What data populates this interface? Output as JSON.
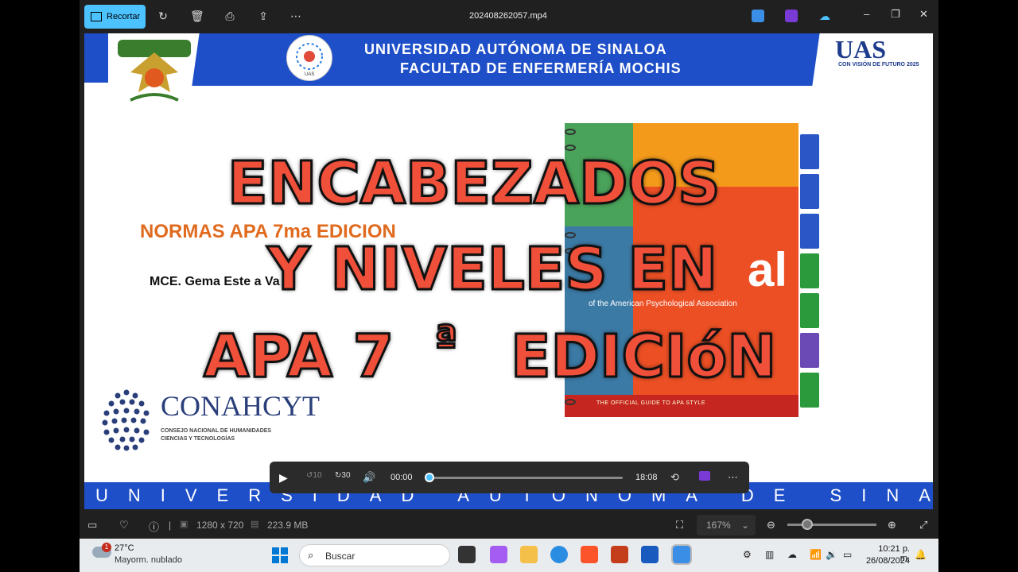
{
  "titlebar": {
    "crop_label": "Recortar",
    "file_name": "202408262057.mp4"
  },
  "slide": {
    "header_line1": "UNIVERSIDAD AUTÓNOMA DE SINALOA",
    "header_line2": "FACULTAD DE ENFERMERÍA MOCHIS",
    "uas_logo_text": "UAS",
    "uas_tagline": "CON VISIÓN DE FUTURO 2025",
    "uas_small_label": "UAS",
    "normas": "NORMAS APA 7ma EDICION",
    "author": "MCE. Gema Este    a Va",
    "book_subtitle": "of the American Psychological Association",
    "book_footer": "THE OFFICIAL GUIDE TO APA STYLE",
    "book_big_letters": "al",
    "conahcyt": "CONAHCYT",
    "conahcyt_sub1": "CONSEJO NACIONAL DE HUMANIDADES",
    "conahcyt_sub2": "CIENCIAS Y TECNOLOGÍAS",
    "footer_band": "UNIVERSIDAD AUTONOMA DE SINALOA"
  },
  "overlay": {
    "line1": "ENCABEZADOS",
    "line2": "Y NIVELES EN",
    "line3a": "APA 7",
    "line3b": "ª",
    "line3c": "EDICIóN"
  },
  "player": {
    "current_time": "00:00",
    "total_time": "18:08",
    "skip_back_label": "10",
    "skip_fwd_label": "30",
    "progress": 0.0
  },
  "statusbar": {
    "dimensions": "1280 x 720",
    "file_size": "223.9 MB",
    "zoom": "167%"
  },
  "taskbar": {
    "weather_temp": "27°C",
    "weather_desc": "Mayorm. nublado",
    "notif_count": "1",
    "search_label": "Buscar",
    "time": "10:21 p. m.",
    "date": "26/08/2024"
  },
  "colors": {
    "accent": "#4cc2ff",
    "uas_blue": "#1e4fc8",
    "overlay_red": "#f0503a",
    "normas_orange": "#e06a1e"
  }
}
